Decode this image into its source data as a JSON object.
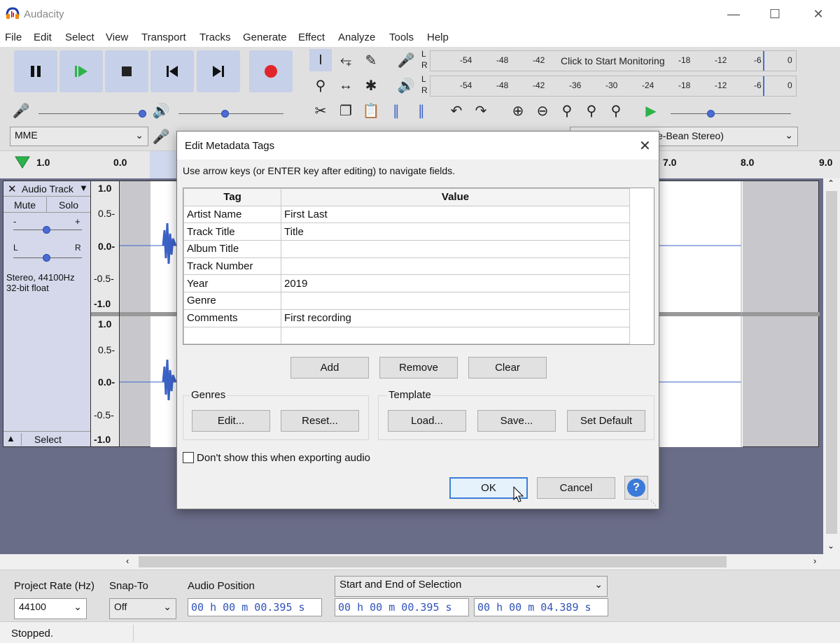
{
  "window": {
    "title": "Audacity"
  },
  "menu": [
    "File",
    "Edit",
    "Select",
    "View",
    "Transport",
    "Tracks",
    "Generate",
    "Effect",
    "Analyze",
    "Tools",
    "Help"
  ],
  "meters": {
    "record_ticks": [
      "-54",
      "-48",
      "-42",
      "Click to Start Monitoring",
      "-18",
      "-12",
      "-6",
      "0"
    ],
    "play_ticks": [
      "-54",
      "-48",
      "-42",
      "-36",
      "-30",
      "-24",
      "-18",
      "-12",
      "-6",
      "0"
    ],
    "lr": [
      "L",
      "R"
    ]
  },
  "device": {
    "host": "MME",
    "output_partial": "e-Bean Stereo)"
  },
  "timeline": {
    "ticks": [
      "1.0",
      "0.0",
      "7.0",
      "8.0",
      "9.0"
    ]
  },
  "track": {
    "name": "Audio Track",
    "mute": "Mute",
    "solo": "Solo",
    "pan_l": "L",
    "pan_r": "R",
    "gain_minus": "-",
    "gain_plus": "+",
    "info_line1": "Stereo, 44100Hz",
    "info_line2": "32-bit float",
    "select": "Select",
    "scale": [
      "1.0",
      "0.5-",
      "0.0-",
      "-0.5-",
      "-1.0"
    ]
  },
  "dialog": {
    "title": "Edit Metadata Tags",
    "instructions": "Use arrow keys (or ENTER key after editing) to navigate fields.",
    "col_tag": "Tag",
    "col_value": "Value",
    "rows": [
      {
        "tag": "Artist Name",
        "value": "First Last"
      },
      {
        "tag": "Track Title",
        "value": "Title"
      },
      {
        "tag": "Album Title",
        "value": ""
      },
      {
        "tag": "Track Number",
        "value": ""
      },
      {
        "tag": "Year",
        "value": "2019"
      },
      {
        "tag": "Genre",
        "value": ""
      },
      {
        "tag": "Comments",
        "value": "First recording"
      },
      {
        "tag": "",
        "value": ""
      }
    ],
    "add": "Add",
    "remove": "Remove",
    "clear": "Clear",
    "genres_label": "Genres",
    "genres_edit": "Edit...",
    "genres_reset": "Reset...",
    "template_label": "Template",
    "template_load": "Load...",
    "template_save": "Save...",
    "template_default": "Set Default",
    "dont_show": "Don't show this when exporting audio",
    "ok": "OK",
    "cancel": "Cancel",
    "help": "?"
  },
  "selection": {
    "project_rate_label": "Project Rate (Hz)",
    "project_rate": "44100",
    "snap_label": "Snap-To",
    "snap": "Off",
    "audio_pos_label": "Audio Position",
    "audio_pos": "00 h 00 m 00.395 s",
    "sel_mode": "Start and End of Selection",
    "sel_start": "00 h 00 m 00.395 s",
    "sel_end": "00 h 00 m 04.389 s"
  },
  "status": "Stopped."
}
